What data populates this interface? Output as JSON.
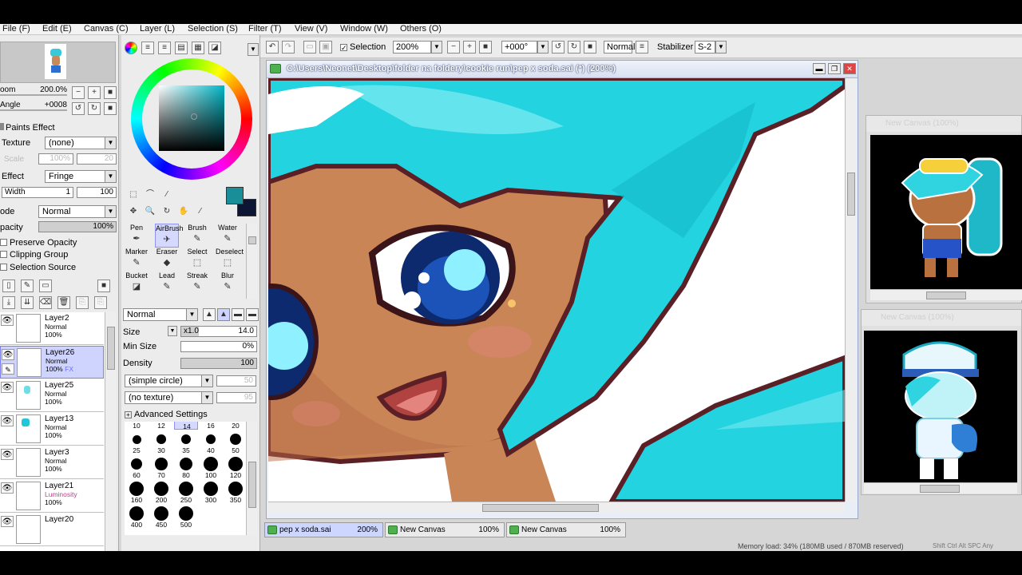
{
  "menu": [
    "File (F)",
    "Edit (E)",
    "Canvas (C)",
    "Layer (L)",
    "Selection (S)",
    "Filter (T)",
    "View (V)",
    "Window (W)",
    "Others (O)"
  ],
  "toolbar": {
    "selection_label": "Selection",
    "selection_checked": true,
    "zoom": "200%",
    "rotation": "+000°",
    "blend": "Normal",
    "stabilizer_label": "Stabilizer",
    "stabilizer_value": "S-2"
  },
  "navigator": {
    "zoom_label": "oom",
    "zoom_value": "200.0%",
    "angle_label": "Angle",
    "angle_value": "+0008"
  },
  "paints_effect": {
    "header": "Paints Effect",
    "texture_label": "Texture",
    "texture_value": "(none)",
    "scale_label": "Scale",
    "scale_value": "100%",
    "scale_num": "20",
    "effect_label": "Effect",
    "effect_value": "Fringe",
    "width_label": "Width",
    "width_value": "1",
    "width_num": "100"
  },
  "layer_props": {
    "mode_label": "ode",
    "mode_value": "Normal",
    "opacity_label": "pacity",
    "opacity_value": "100%",
    "preserve_opacity": "Preserve Opacity",
    "clipping_group": "Clipping Group",
    "selection_source": "Selection Source"
  },
  "layers": [
    {
      "name": "Layer2",
      "mode": "Normal",
      "opacity": "100%",
      "active": false
    },
    {
      "name": "Layer26",
      "mode": "Normal",
      "opacity": "100%",
      "fx": "FX",
      "active": true
    },
    {
      "name": "Layer25",
      "mode": "Normal",
      "opacity": "100%",
      "active": false
    },
    {
      "name": "Layer13",
      "mode": "Normal",
      "opacity": "100%",
      "active": false
    },
    {
      "name": "Layer3",
      "mode": "Normal",
      "opacity": "100%",
      "active": false
    },
    {
      "name": "Layer21",
      "mode": "Luminosity",
      "opacity": "100%",
      "active": false
    },
    {
      "name": "Layer20",
      "mode": "",
      "opacity": "",
      "active": false
    }
  ],
  "tools": [
    [
      "Pen",
      "AirBrush",
      "Brush",
      "Water"
    ],
    [
      "Marker",
      "Eraser",
      "Select",
      "Deselect"
    ],
    [
      "Bucket",
      "Lead",
      "Streak",
      "Blur"
    ]
  ],
  "brush": {
    "blend": "Normal",
    "size_label": "Size",
    "size_mult": "x1.0",
    "size_value": "14.0",
    "minsize_label": "Min Size",
    "minsize_value": "0%",
    "density_label": "Density",
    "density_value": "100",
    "shape": "(simple circle)",
    "shape_num": "50",
    "texture": "(no texture)",
    "texture_num": "95",
    "advanced": "Advanced Settings",
    "sizes": [
      "10",
      "12",
      "14",
      "16",
      "20",
      "25",
      "30",
      "35",
      "40",
      "50",
      "60",
      "70",
      "80",
      "100",
      "120",
      "160",
      "200",
      "250",
      "300",
      "350",
      "400",
      "450",
      "500"
    ],
    "selected_size": "14"
  },
  "colors": {
    "foreground": "#1a8e98",
    "background": "#0c1533",
    "accent_teal": "#2ad4e0"
  },
  "canvas": {
    "title": "C:\\Users\\Neonet\\Desktop\\folder na foldery\\cookie run\\pep x soda.sai (*) (200%)"
  },
  "subwindows": [
    {
      "title": "New Canvas (100%)"
    },
    {
      "title": "New Canvas (100%)"
    }
  ],
  "tabs": [
    {
      "name": "pep x soda.sai",
      "zoom": "200%",
      "active": true
    },
    {
      "name": "New Canvas",
      "zoom": "100%",
      "active": false
    },
    {
      "name": "New Canvas",
      "zoom": "100%",
      "active": false
    }
  ],
  "status": {
    "memory": "Memory load: 34% (180MB used / 870MB reserved)",
    "keys": "Shift Ctrl Alt SPC Any"
  }
}
